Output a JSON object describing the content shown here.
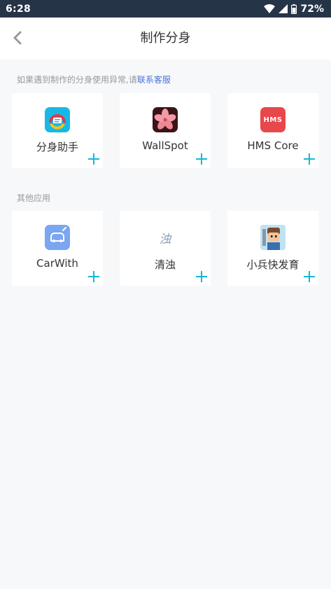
{
  "status_bar": {
    "time": "6:28",
    "battery": "72%"
  },
  "header": {
    "title": "制作分身"
  },
  "notice": {
    "text": "如果遇到制作的分身使用异常,请",
    "link": "联系客服"
  },
  "sections": [
    {
      "label": "",
      "apps": [
        {
          "name": "分身助手",
          "icon": "clone-assistant-icon"
        },
        {
          "name": "WallSpot",
          "icon": "wallspot-icon"
        },
        {
          "name": "HMS Core",
          "icon": "hms-core-icon",
          "icon_text": "HMS"
        }
      ]
    },
    {
      "label": "其他应用",
      "apps": [
        {
          "name": "CarWith",
          "icon": "carwith-icon"
        },
        {
          "name": "清浊",
          "icon": "qingzhuo-icon",
          "icon_text": "浊"
        },
        {
          "name": "小兵快发育",
          "icon": "soldier-game-icon"
        }
      ]
    }
  ],
  "colors": {
    "status_bar": "#263447",
    "accent": "#17b6d6",
    "link": "#4a73d9",
    "background": "#f7f8fa"
  }
}
